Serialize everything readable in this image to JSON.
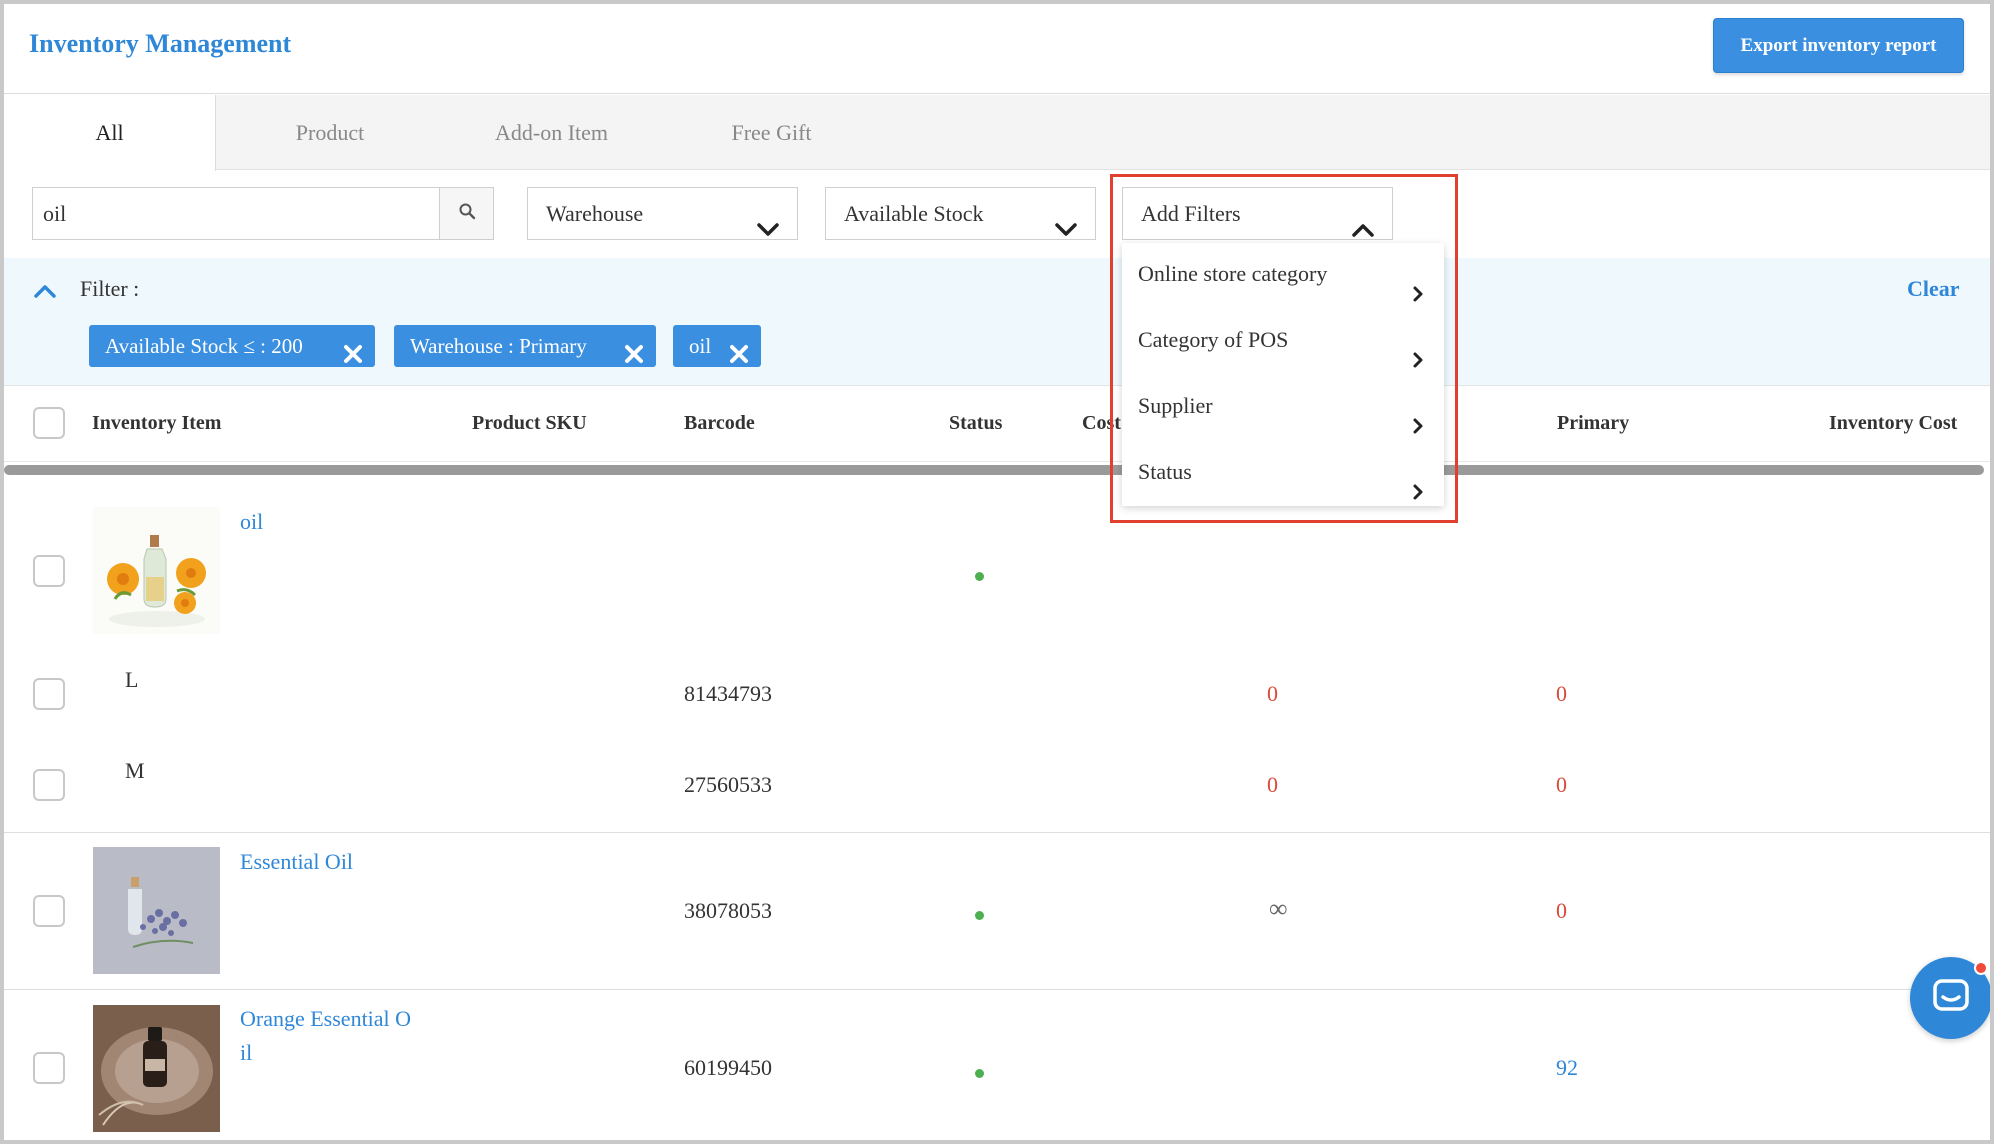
{
  "header": {
    "title": "Inventory Management",
    "export_label": "Export inventory report"
  },
  "tabs": [
    {
      "label": "All",
      "active": true
    },
    {
      "label": "Product",
      "active": false
    },
    {
      "label": "Add-on Item",
      "active": false
    },
    {
      "label": "Free Gift",
      "active": false
    }
  ],
  "toolbar": {
    "search_value": "oil",
    "warehouse_label": "Warehouse",
    "stock_label": "Available Stock",
    "add_filters_label": "Add Filters"
  },
  "filter": {
    "label": "Filter :",
    "clear_label": "Clear",
    "chips": [
      "Available Stock ≤ : 200",
      "Warehouse : Primary",
      "oil"
    ]
  },
  "table": {
    "headers": {
      "item": "Inventory Item",
      "sku": "Product SKU",
      "barcode": "Barcode",
      "status": "Status",
      "cost": "Cost",
      "primary": "Primary",
      "inventory_cost": "Inventory Cost"
    },
    "rows": [
      {
        "name": "oil",
        "image": "calendula-oil",
        "barcode": "",
        "status_dot": true,
        "stock": "",
        "primary": ""
      },
      {
        "variant": "L",
        "barcode": "81434793",
        "stock": "0",
        "primary": "0"
      },
      {
        "variant": "M",
        "barcode": "27560533",
        "stock": "0",
        "primary": "0"
      },
      {
        "name": "Essential Oil",
        "image": "lavender-oil",
        "barcode": "38078053",
        "status_dot": true,
        "stock": "∞",
        "primary": "0"
      },
      {
        "name_line1": "Orange Essential O",
        "name_line2": "il",
        "image": "amber-bottle",
        "barcode": "60199450",
        "status_dot": true,
        "stock": "",
        "primary": "92"
      }
    ]
  },
  "menu": {
    "items": [
      "Online store category",
      "Category of POS",
      "Supplier",
      "Status"
    ]
  },
  "colors": {
    "accent": "#3a8fe0",
    "highlight": "#e2402f",
    "negative": "#d94a3a",
    "status_active": "#4caf50"
  }
}
